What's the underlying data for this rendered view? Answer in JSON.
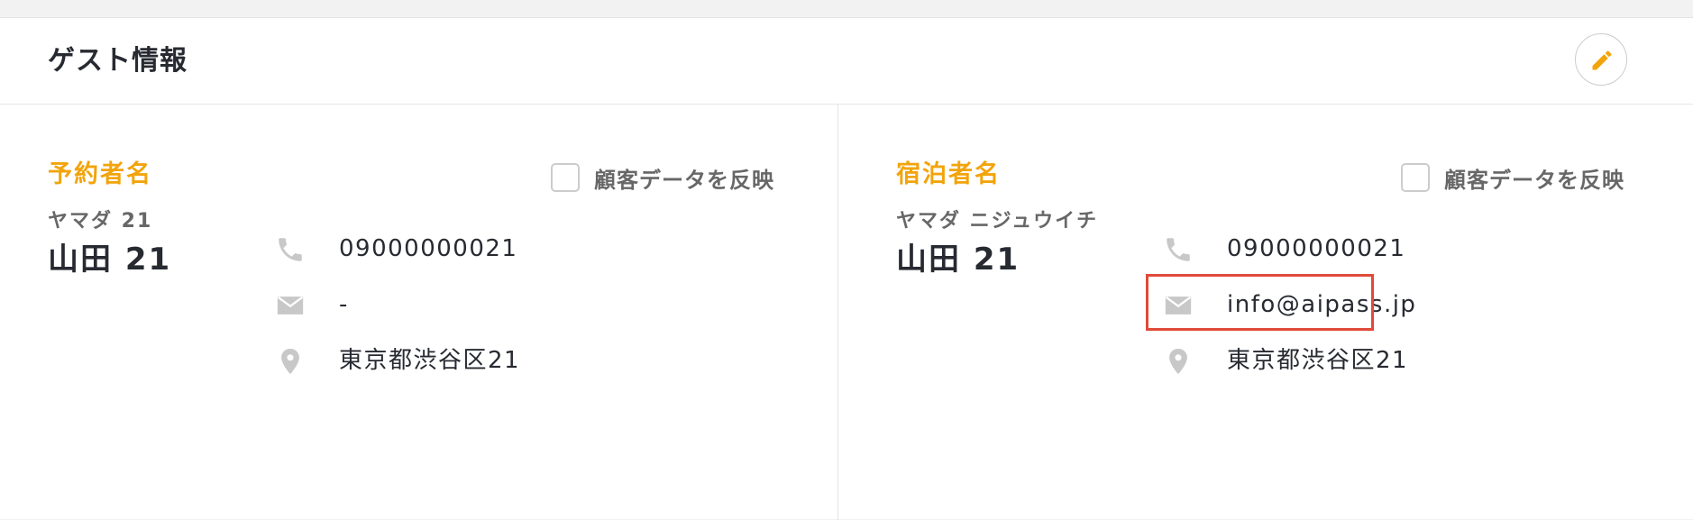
{
  "card": {
    "title": "ゲスト情報"
  },
  "booker": {
    "section_label": "予約者名",
    "reflect_label": "顧客データを反映",
    "kana": "ヤマダ 21",
    "name": "山田 21",
    "phone": "09000000021",
    "email": "-",
    "address": "東京都渋谷区21"
  },
  "guest": {
    "section_label": "宿泊者名",
    "reflect_label": "顧客データを反映",
    "kana": "ヤマダ ニジュウイチ",
    "name": "山田 21",
    "phone": "09000000021",
    "email": "info@aipass.jp",
    "address": "東京都渋谷区21"
  },
  "icons": {
    "edit": "pencil-icon",
    "phone": "phone-icon",
    "email": "mail-icon",
    "address": "map-pin-icon"
  },
  "colors": {
    "accent": "#f2a40c",
    "highlight": "#e04a3a",
    "icon_gray": "#c8c8c8",
    "text": "#272a31"
  }
}
